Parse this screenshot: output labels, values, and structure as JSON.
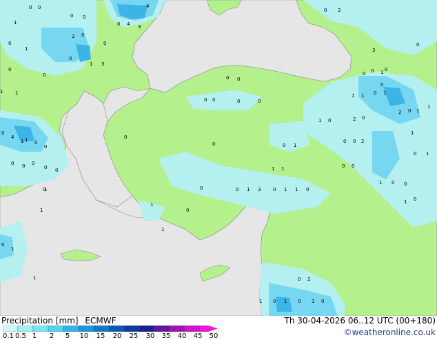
{
  "footer": {
    "title": "Precipitation [mm]",
    "model": "ECMWF",
    "datetime": "Th 30-04-2026 06..12 UTC (00+180)",
    "credit": "©weatheronline.co.uk"
  },
  "legend": {
    "labels": [
      "0.1",
      "0.5",
      "1",
      "2",
      "5",
      "10",
      "15",
      "20",
      "25",
      "30",
      "35",
      "40",
      "45",
      "50"
    ],
    "colors": [
      "#c8fafa",
      "#a0f0f0",
      "#78e6f0",
      "#50d2f0",
      "#32b4e6",
      "#1e96dc",
      "#1478c8",
      "#0a5ab4",
      "#0a3ca0",
      "#1e1e8c",
      "#6414a0",
      "#a014b4",
      "#d214c8",
      "#f014dc"
    ]
  },
  "map_colors": {
    "sea": "#e6e6e6",
    "land_dry": "#b4f08c",
    "light_precip": "#b4f0f0",
    "moderate_precip": "#78d7f0",
    "heavy_precip": "#3cb4e6"
  },
  "map_values": [
    "0",
    "0",
    "1",
    "0",
    "2",
    "0",
    "0",
    "4",
    "4",
    "3",
    "0",
    "1",
    "0",
    "0",
    "0",
    "1",
    "3",
    "0",
    "0",
    "1",
    "0",
    "0",
    "0",
    "0",
    "0",
    "0",
    "3",
    "0",
    "0",
    "1",
    "0",
    "1",
    "1",
    "0",
    "1",
    "0",
    "2",
    "0",
    "1",
    "1",
    "2",
    "0",
    "1",
    "0",
    "0",
    "1",
    "0",
    "0",
    "2",
    "0",
    "1",
    "1",
    "0",
    "0",
    "1",
    "3",
    "0",
    "1",
    "1",
    "0",
    "0",
    "1",
    "1",
    "0",
    "0",
    "1",
    "0",
    "0",
    "1",
    "0",
    "0",
    "1",
    "0",
    "4",
    "1",
    "0",
    "0",
    "0",
    "0",
    "0",
    "0",
    "0",
    "1",
    "1",
    "0",
    "1",
    "1",
    "0",
    "2",
    "1",
    "0",
    "1",
    "0",
    "1",
    "0",
    "1",
    "0",
    "1",
    "0",
    "2",
    "1",
    "0",
    "0",
    "0"
  ]
}
